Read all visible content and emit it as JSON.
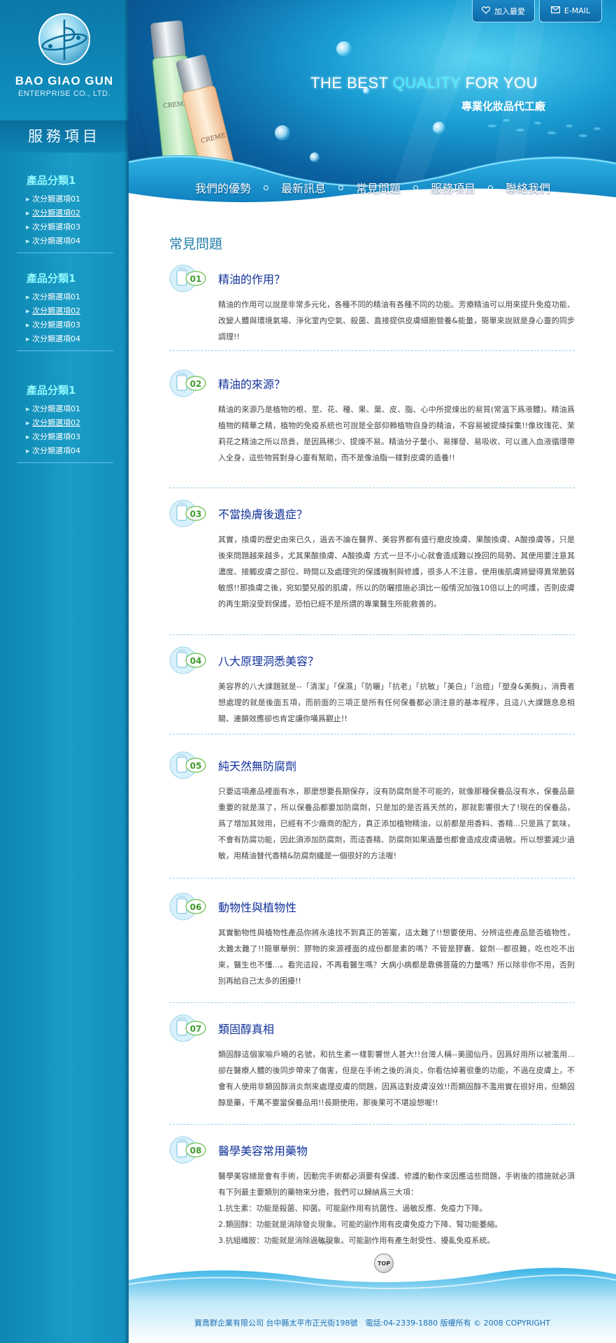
{
  "company": {
    "name_en": "BAO GIAO GUN",
    "name_en_sub": "ENTERPRISE CO., LTD."
  },
  "sidebar": {
    "title": "服務項目",
    "groups": [
      {
        "title": "產品分類1",
        "items": [
          "次分類選項01",
          "次分類選項02",
          "次分類選項03",
          "次分類選項04"
        ]
      },
      {
        "title": "產品分類1",
        "items": [
          "次分類選項01",
          "次分類選項02",
          "次分類選項03",
          "次分類選項04"
        ]
      },
      {
        "title": "產品分類1",
        "items": [
          "次分類選項01",
          "次分類選項02",
          "次分類選項03",
          "次分類選項04"
        ]
      }
    ]
  },
  "header": {
    "btn_favorite": "加入最愛",
    "btn_email": "E-MAIL",
    "tagline_pre": "THE BEST ",
    "tagline_mid": "QUALITY",
    "tagline_post": " FOR YOU",
    "tagline_cn": "專業化妝品代工廠",
    "product_label_1": "CREME ECRAN T",
    "product_label_2": "CREME"
  },
  "nav": {
    "items": [
      "我們的優勢",
      "最新訊息",
      "常見問題",
      "服務項目",
      "聯絡我們"
    ]
  },
  "main": {
    "page_title": "常見問題",
    "faqs": [
      {
        "num": "01",
        "q": "精油的作用？",
        "a": "精油的作用可以說是非常多元化，各種不同的精油有各種不同的功能。芳療精油可以用來提升免疫功能、改變人體與環境氣場、淨化室內空氣、殺菌、直接提供皮膚細胞營養&能量，簡單來說就是身心靈的同步調理!!"
      },
      {
        "num": "02",
        "q": "精油的來源？",
        "a": "精油的來源乃是植物的根、莖、花、種、果、葉、皮、脂、心中所提煉出的易質(常溫下爲液體)。精油爲植物的精華之精，植物的免疫系統也可說是全部仰賴植物自身的精油，不容易被提煉採集!!像玫瑰花、茉莉花之精油之所以昂貴，是因爲稀少、提煉不易。精油分子量小、易揮發、易吸收、可以進入血液循環帶入全身，這些物質對身心靈有幫助，而不是像油脂一樣對皮膚的造養!!"
      },
      {
        "num": "03",
        "q": "不當換膚後遺症？",
        "a": "其實，換膚的歷史由來已久，過去不論在醫界、美容界都有盛行磨皮換膚、果酸換膚、A酸換膚等，只是後來問題越來越多，尤其果酸換膚、A酸換膚 方式一旦不小心就會造成難以挽回的局勢。其使用要注意其濃度、接觸皮膚之部位、時間以及處理完的保護機制與修護，很多人不注意，使用後肌膚將變得異常脆弱敏感!!那換膚之後，宛如嬰兒般的肌膚，所以的防曬措施必須比一般情況加強10倍以上的呵護，否則皮膚的再生期沒受到保護，恐怕已經不是所謂的專業醫生所能救善的。"
      },
      {
        "num": "04",
        "q": "八大原理洞悉美容？",
        "a": "美容界的八大課題就是--「清潔」「保濕」「防曬」「抗老」「抗敏」「美白」「治痘」「塑身&美胸」，消費者想處理的就是後面五項，而前面的三項正是所有任何保養都必須注意的基本程序，且這八大課題息息相關、連鎖效應卻也肯定讓你嘆爲觀止!!"
      },
      {
        "num": "05",
        "q": "純天然無防腐劑",
        "a": "只要這項產品裡面有水，那麼想要長期保存，沒有防腐劑是不可能的，就像那種保養品沒有水，保養品最重要的就是濕了，所以保養品都要加防腐劑，只是加的是否爲天然的，那就影響很大了!現在的保養品，爲了增加其效用，已經有不少廠商的配方，真正添加植物精油，以前都是用香料、香精...只是爲了氣味，不會有防腐功能，因此須添加防腐劑，而這香精、防腐劑如果過量也都會造成皮膚過敏。所以想要減少過敏，用精油替代香精&防腐劑纔是一個很好的方法喔!"
      },
      {
        "num": "06",
        "q": "動物性與植物性",
        "a": "其實動物性與植物性產品你將永遠找不到真正的答案，這太難了!!想要使用、分辨這些產品是否植物性，太難太難了!!簡單舉例：膠物的來源裡面的成份都是素的嗎？不管是膠囊、錠劑⋯都很難，吃也吃不出來，醫生也不懂...。看完這段，不再看醫生嗎？大病小病都是靠佛菩薩的力量嗎？所以除非你不用，否則別再給自己太多的困擾!!"
      },
      {
        "num": "07",
        "q": "類固醇真相",
        "a": "類固醇這個家喻戶曉的名號，和抗生素一樣影響世人甚大!!台灣人稱--美國仙丹，因爲好用所以被濫用...卻在醫療人體的後同步帶來了傷害，但是在手術之後的消炎，你看估掉著很重的功能，不過在皮膚上，不會有人使用非類固醇消炎劑來處理皮膚的問題，因爲這對皮膚沒效!!而類固醇不濫用實在很好用，但類固醇是藥，千萬不要當保養品用!!長期使用，那後果可不堪設想喔!!"
      },
      {
        "num": "08",
        "q": "醫學美容常用藥物",
        "a": "醫學美容總是會有手術，因動完手術都必須要有保護、修護的動作來因應這些問題，手術後的措施就必須有下列最主要類別的藥物來分擔，我們可以歸納爲三大項：\n1.抗生素：功能是殺菌、抑菌。可能副作用有抗菌性、過敏反應、免疫力下降。\n2.類固醇：功能就是消除發炎現象。可能的副作用有皮膚免疫力下降、腎功能萎縮。\n3.抗組織胺：功能就是消除過敏現象。可能副作用有產生耐受性、擾亂免疫系統。"
      }
    ],
    "top_label": "TOP",
    "top_button": "TOP"
  },
  "footer": {
    "text": "寶喬群企業有限公司 台中縣太平市正光街198號　電話:04-2339-1880  版權所有 © 2008 COPYRIGHT"
  },
  "colors": {
    "sidebar_bg": "#1a9cc6",
    "category_title": "#8ff7ff",
    "question_text": "#12329a",
    "page_title": "#2680a8",
    "footer_text": "#1e6fb4"
  },
  "icons": [
    "heart-icon",
    "mail-icon",
    "faq-badge-icon",
    "bullet-arrow-icon"
  ]
}
